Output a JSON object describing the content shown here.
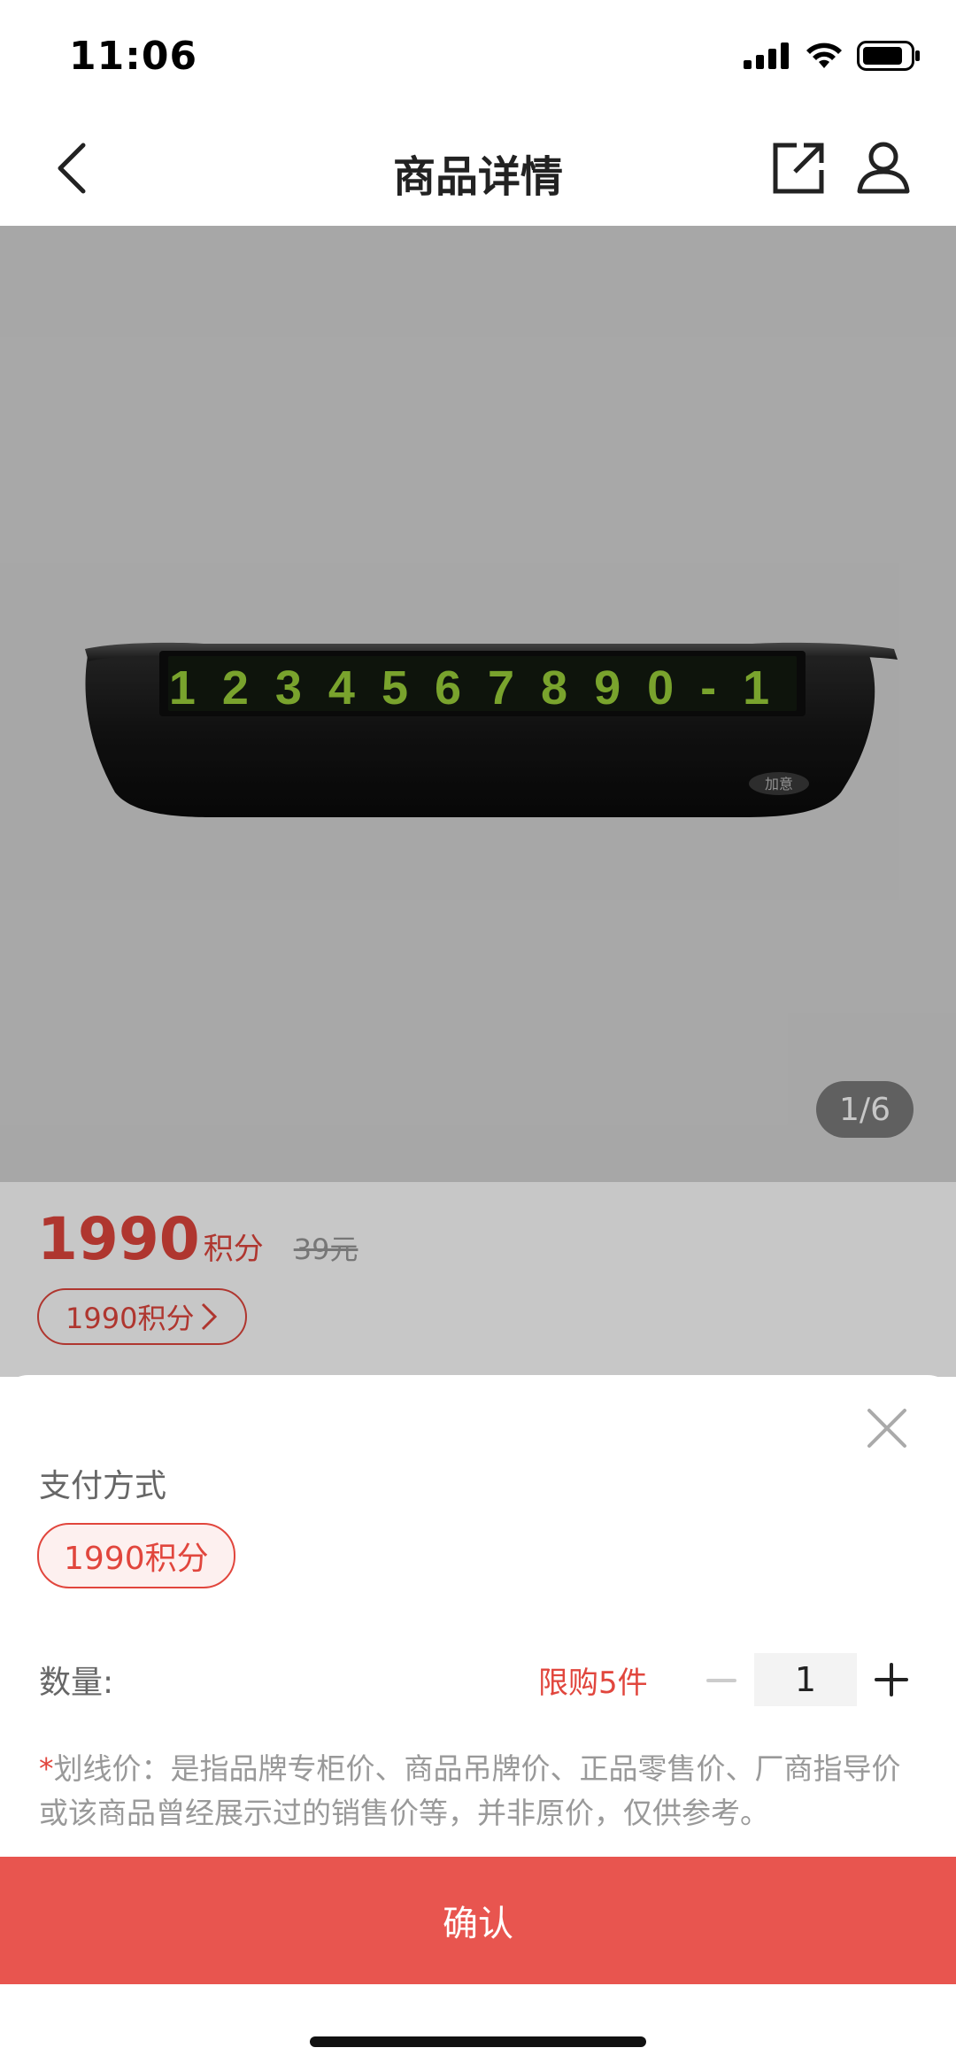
{
  "status_bar": {
    "time": "11:06",
    "icons": [
      "signal-icon",
      "wifi-icon",
      "battery-icon"
    ]
  },
  "nav": {
    "title": "商品详情",
    "icons": [
      "back-icon",
      "share-icon",
      "user-icon"
    ]
  },
  "product": {
    "plate_numbers": "1234567890-1",
    "brand_badge": "加意",
    "page_indicator": "1/6",
    "image_bg_color": "#d7d7d7"
  },
  "price": {
    "points_value": "1990",
    "points_unit": "积分",
    "original_price": "39元",
    "points_tag": "1990积分"
  },
  "sheet": {
    "payment_label": "支付方式",
    "payment_option": "1990积分",
    "quantity_label": "数量:",
    "limit_text": "限购5件",
    "quantity_value": "1",
    "note_star": "*",
    "note_text": "划线价：是指品牌专柜价、商品吊牌价、正品零售价、厂商指导价或该商品曾经展示过的销售价等，并非原价，仅供参考。",
    "confirm_label": "确认"
  },
  "colors": {
    "accent": "#e1463d",
    "confirm_bg": "#e8554f"
  }
}
